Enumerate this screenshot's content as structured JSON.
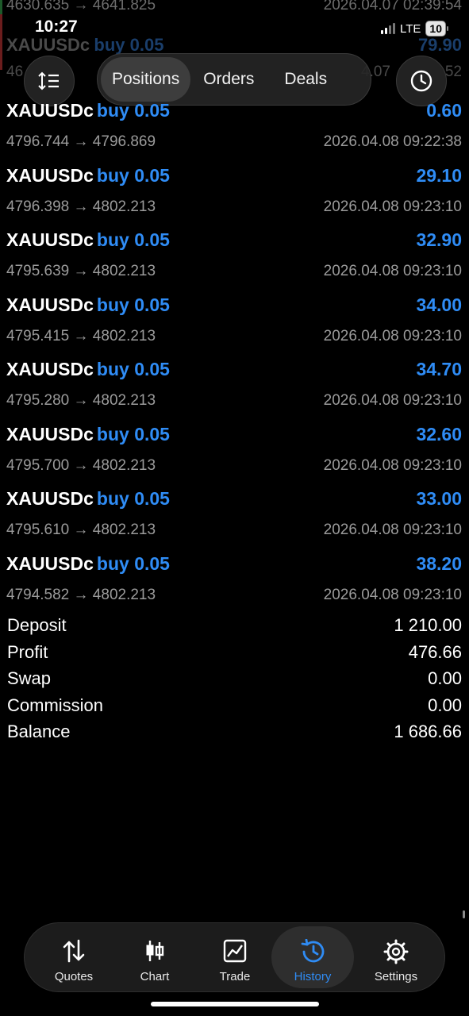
{
  "status_bar": {
    "time": "10:27",
    "network": "LTE",
    "battery": "10"
  },
  "header": {
    "sort_icon": "sort-icon",
    "clock_icon": "history-clock-icon",
    "tabs": [
      {
        "label": "Positions",
        "active": true
      },
      {
        "label": "Orders",
        "active": false
      },
      {
        "label": "Deals",
        "active": false
      }
    ]
  },
  "partial_rows": [
    {
      "prices": "4630.635 → 4641.825",
      "time": "2026.04.07 02:39:54"
    },
    {
      "symbol": "XAUUSDc",
      "side": "buy 0.05",
      "profit": "79.90",
      "prices": "46",
      "time": "4.07",
      "time_tail": "52"
    }
  ],
  "deals": [
    {
      "symbol": "XAUUSDc",
      "side": "buy 0.05",
      "profit": "0.60",
      "prices": "4796.744 → 4796.869",
      "time": "2026.04.08 09:22:38"
    },
    {
      "symbol": "XAUUSDc",
      "side": "buy 0.05",
      "profit": "29.10",
      "prices": "4796.398 → 4802.213",
      "time": "2026.04.08 09:23:10"
    },
    {
      "symbol": "XAUUSDc",
      "side": "buy 0.05",
      "profit": "32.90",
      "prices": "4795.639 → 4802.213",
      "time": "2026.04.08 09:23:10"
    },
    {
      "symbol": "XAUUSDc",
      "side": "buy 0.05",
      "profit": "34.00",
      "prices": "4795.415 → 4802.213",
      "time": "2026.04.08 09:23:10"
    },
    {
      "symbol": "XAUUSDc",
      "side": "buy 0.05",
      "profit": "34.70",
      "prices": "4795.280 → 4802.213",
      "time": "2026.04.08 09:23:10"
    },
    {
      "symbol": "XAUUSDc",
      "side": "buy 0.05",
      "profit": "32.60",
      "prices": "4795.700 → 4802.213",
      "time": "2026.04.08 09:23:10"
    },
    {
      "symbol": "XAUUSDc",
      "side": "buy 0.05",
      "profit": "33.00",
      "prices": "4795.610 → 4802.213",
      "time": "2026.04.08 09:23:10"
    },
    {
      "symbol": "XAUUSDc",
      "side": "buy 0.05",
      "profit": "38.20",
      "prices": "4794.582 → 4802.213",
      "time": "2026.04.08 09:23:10"
    }
  ],
  "summary": {
    "deposit_label": "Deposit",
    "deposit": "1 210.00",
    "profit_label": "Profit",
    "profit": "476.66",
    "swap_label": "Swap",
    "swap": "0.00",
    "commission_label": "Commission",
    "commission": "0.00",
    "balance_label": "Balance",
    "balance": "1 686.66"
  },
  "bottom_nav": [
    {
      "label": "Quotes",
      "icon": "quotes-arrows-icon",
      "active": false
    },
    {
      "label": "Chart",
      "icon": "candlestick-chart-icon",
      "active": false
    },
    {
      "label": "Trade",
      "icon": "trade-chart-icon",
      "active": false
    },
    {
      "label": "History",
      "icon": "history-clock-icon",
      "active": true
    },
    {
      "label": "Settings",
      "icon": "gear-icon",
      "active": false
    }
  ],
  "colors": {
    "accent": "#2f8cf5",
    "background": "#000000",
    "muted_text": "#9b9b9b"
  }
}
